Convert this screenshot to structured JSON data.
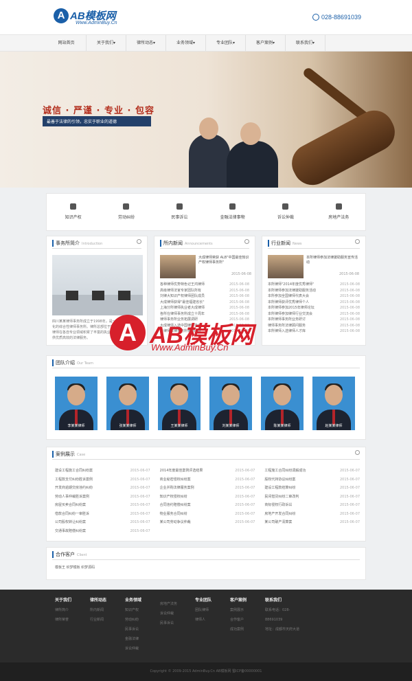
{
  "header": {
    "logo_mark": "A",
    "logo_text": "AB模板网",
    "logo_sub": "Www.AdminBuy.Cn",
    "phone": "028-88691039"
  },
  "nav": [
    "网站首页",
    "关于我们▾",
    "律所动态▾",
    "业务领域▾",
    "专业团队▾",
    "客户案例▾",
    "联系我们▾"
  ],
  "banner": {
    "slogan": "诚信 · 严谨 · 专业 · 包容",
    "sub": "最善于法律的引领，忠实于职业的道德"
  },
  "services": [
    {
      "label": "知识产权",
      "icon": "book-icon"
    },
    {
      "label": "劳动纠纷",
      "icon": "person-icon"
    },
    {
      "label": "民事诉讼",
      "icon": "building-icon"
    },
    {
      "label": "金融法律事物",
      "icon": "money-bag-icon"
    },
    {
      "label": "诉讼仲裁",
      "icon": "runner-icon"
    },
    {
      "label": "房地产法务",
      "icon": "bag-icon"
    }
  ],
  "about": {
    "title": "事务所简介",
    "en": "Introduction",
    "text": "四川某某律师事务所成立于1998年，是一家专业化、规模化的综合性律师事务所。律所总部位于四川省成都市，本所律师在各自专业领域积累了丰富的执业经验，竭诚为客户提供优质高效的法律服务。"
  },
  "news": {
    "title": "所内新闻",
    "en": "Announcements",
    "feat_title": "大成律师荣获 ALB\"中国最佳知识产权律师事务所\"",
    "feat_date": "2015-06-08",
    "rows": [
      [
        "各种律师优势特色记王鸿律师",
        "2015-06-08"
      ],
      [
        "高级律师法官专家团队所有",
        "2015-06-08"
      ],
      [
        "刘律大知识产权律师团队成员",
        "2015-06-08"
      ],
      [
        "大成律师获得\"最佳福建省长\"",
        "2015-06-08"
      ],
      [
        "上海分所律师执业者大成律师",
        "2015-06-08"
      ],
      [
        "各所在律师事务所成立十周年",
        "2015-06-08"
      ],
      [
        "律师事务所业务拓展调研",
        "2015-06-08"
      ],
      [
        "大成律师入选中国律师协会",
        "2015-06-08"
      ],
      [
        "各律师法律事务所律师团队",
        "2015-06-08"
      ]
    ]
  },
  "news2": {
    "title": "行业新闻",
    "en": "News",
    "feat_title": "本所律师参加法律援助服务宣传活动",
    "feat_date": "2015-06-08",
    "rows": [
      [
        "本所律师\"2014年度优秀律师\"",
        "2015-06-08"
      ],
      [
        "本所律师参加法律援助服务活动",
        "2015-06-08"
      ],
      [
        "本所参加全国律师代表大会",
        "2015-06-08"
      ],
      [
        "本所律师获评优秀律师个人",
        "2015-06-08"
      ],
      [
        "本所律师参加2015年律师论坛",
        "2015-06-08"
      ],
      [
        "本所律师参加律师行业交流会",
        "2015-06-08"
      ],
      [
        "本所律师事务所业务研讨",
        "2015-06-08"
      ],
      [
        "律师事务所法律顾问服务",
        "2015-06-08"
      ],
      [
        "本所律师入选律师人才库",
        "2015-06-08"
      ]
    ]
  },
  "team": {
    "title": "团队介绍",
    "en": "Our Team",
    "members": [
      "李某某律师",
      "张某某律师",
      "王某某律师",
      "刘某某律师",
      "陈某某律师",
      "赵某某律师"
    ]
  },
  "cases": {
    "title": "案例展示",
    "en": "Case",
    "col1": [
      [
        "建设工程施工合同纠纷案",
        "2015-06-07"
      ],
      [
        "工程款支付纠纷胜诉案例",
        "2015-06-07"
      ],
      [
        "开发商逾期交房违约纠纷",
        "2015-06-07"
      ],
      [
        "劳动人事仲裁胜诉案例",
        "2015-06-07"
      ],
      [
        "房屋买卖合同纠纷案",
        "2015-06-07"
      ],
      [
        "借款合同纠纷一审胜诉",
        "2015-06-07"
      ],
      [
        "公司股权转让纠纷案",
        "2015-06-07"
      ],
      [
        "交通事故赔偿纠纷案",
        "2015-06-07"
      ]
    ],
    "col2": [
      [
        "2014年度最佳案例评选结果",
        "2015-06-07"
      ],
      [
        "商业秘密侵权纠纷案",
        "2015-06-07"
      ],
      [
        "企业并购法律服务案例",
        "2015-06-07"
      ],
      [
        "知识产权侵权纠纷",
        "2015-06-07"
      ],
      [
        "合同违约赔偿纠纷案",
        "2015-06-07"
      ],
      [
        "物业服务合同纠纷",
        "2015-06-07"
      ],
      [
        "某公司劳动争议仲裁",
        "2015-06-07"
      ]
    ],
    "col3": [
      [
        "工程施工合同纠纷调解成功",
        "2015-06-07"
      ],
      [
        "股权代持协议纠纷案",
        "2015-06-07"
      ],
      [
        "建设工程款结算纠纷",
        "2015-06-07"
      ],
      [
        "民间借贷纠纷二审改判",
        "2015-06-07"
      ],
      [
        "商标侵权行政诉讼",
        "2015-06-07"
      ],
      [
        "房地产开发合同纠纷",
        "2015-06-07"
      ],
      [
        "某公司破产清算案",
        "2015-06-07"
      ]
    ]
  },
  "partner": {
    "title": "合作客户",
    "en": "Client",
    "text": "模板王 织梦模板 织梦源码"
  },
  "footer": {
    "cols": [
      {
        "h": "关于我们",
        "items": [
          "律所简介",
          "律所荣誉"
        ]
      },
      {
        "h": "律所动态",
        "items": [
          "所内新闻",
          "行业新闻"
        ]
      },
      {
        "h": "业务领域",
        "items": [
          "知识产权",
          "劳动纠纷",
          "民事诉讼",
          "金融法律",
          "诉讼仲裁"
        ]
      },
      {
        "h": "",
        "items": [
          "房地产法务",
          "诉讼仲裁",
          "民事诉讼"
        ]
      },
      {
        "h": "专业团队",
        "items": [
          "团队律师",
          "律师人"
        ]
      },
      {
        "h": "客户案例",
        "items": [
          "案例展示",
          "合作客户",
          "成功案例"
        ]
      },
      {
        "h": "联系我们",
        "items": [
          "联系电话：028-88691039",
          "地址：成都市天府大道"
        ]
      }
    ],
    "copyright": "Copyright © 2009-2015 AdminBuy.Cn AB模板网 蜀ICP备00000001"
  },
  "watermark": {
    "mark": "A",
    "text": "AB模板网",
    "sub": "Www.AdminBuy.Cn"
  }
}
